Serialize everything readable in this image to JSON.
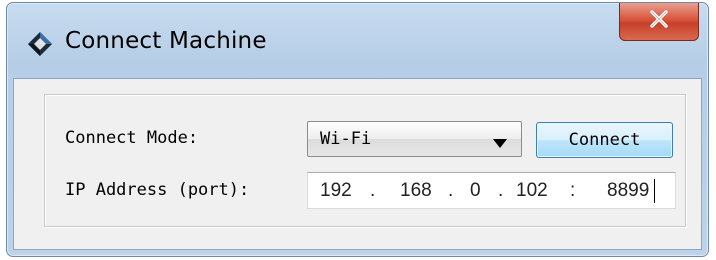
{
  "window": {
    "title": "Connect Machine",
    "app_icon": "diamond-app-icon",
    "close_icon": "close-icon"
  },
  "form": {
    "connect_mode_label": "Connect Mode:",
    "connect_mode_value": "Wi-Fi",
    "connect_button_label": "Connect",
    "ip_label": "IP Address (port):",
    "ip": {
      "octet1": "192",
      "octet2": "168",
      "octet3": "0",
      "octet4": "102",
      "port": "8899",
      "dot": ".",
      "colon": ":"
    }
  }
}
